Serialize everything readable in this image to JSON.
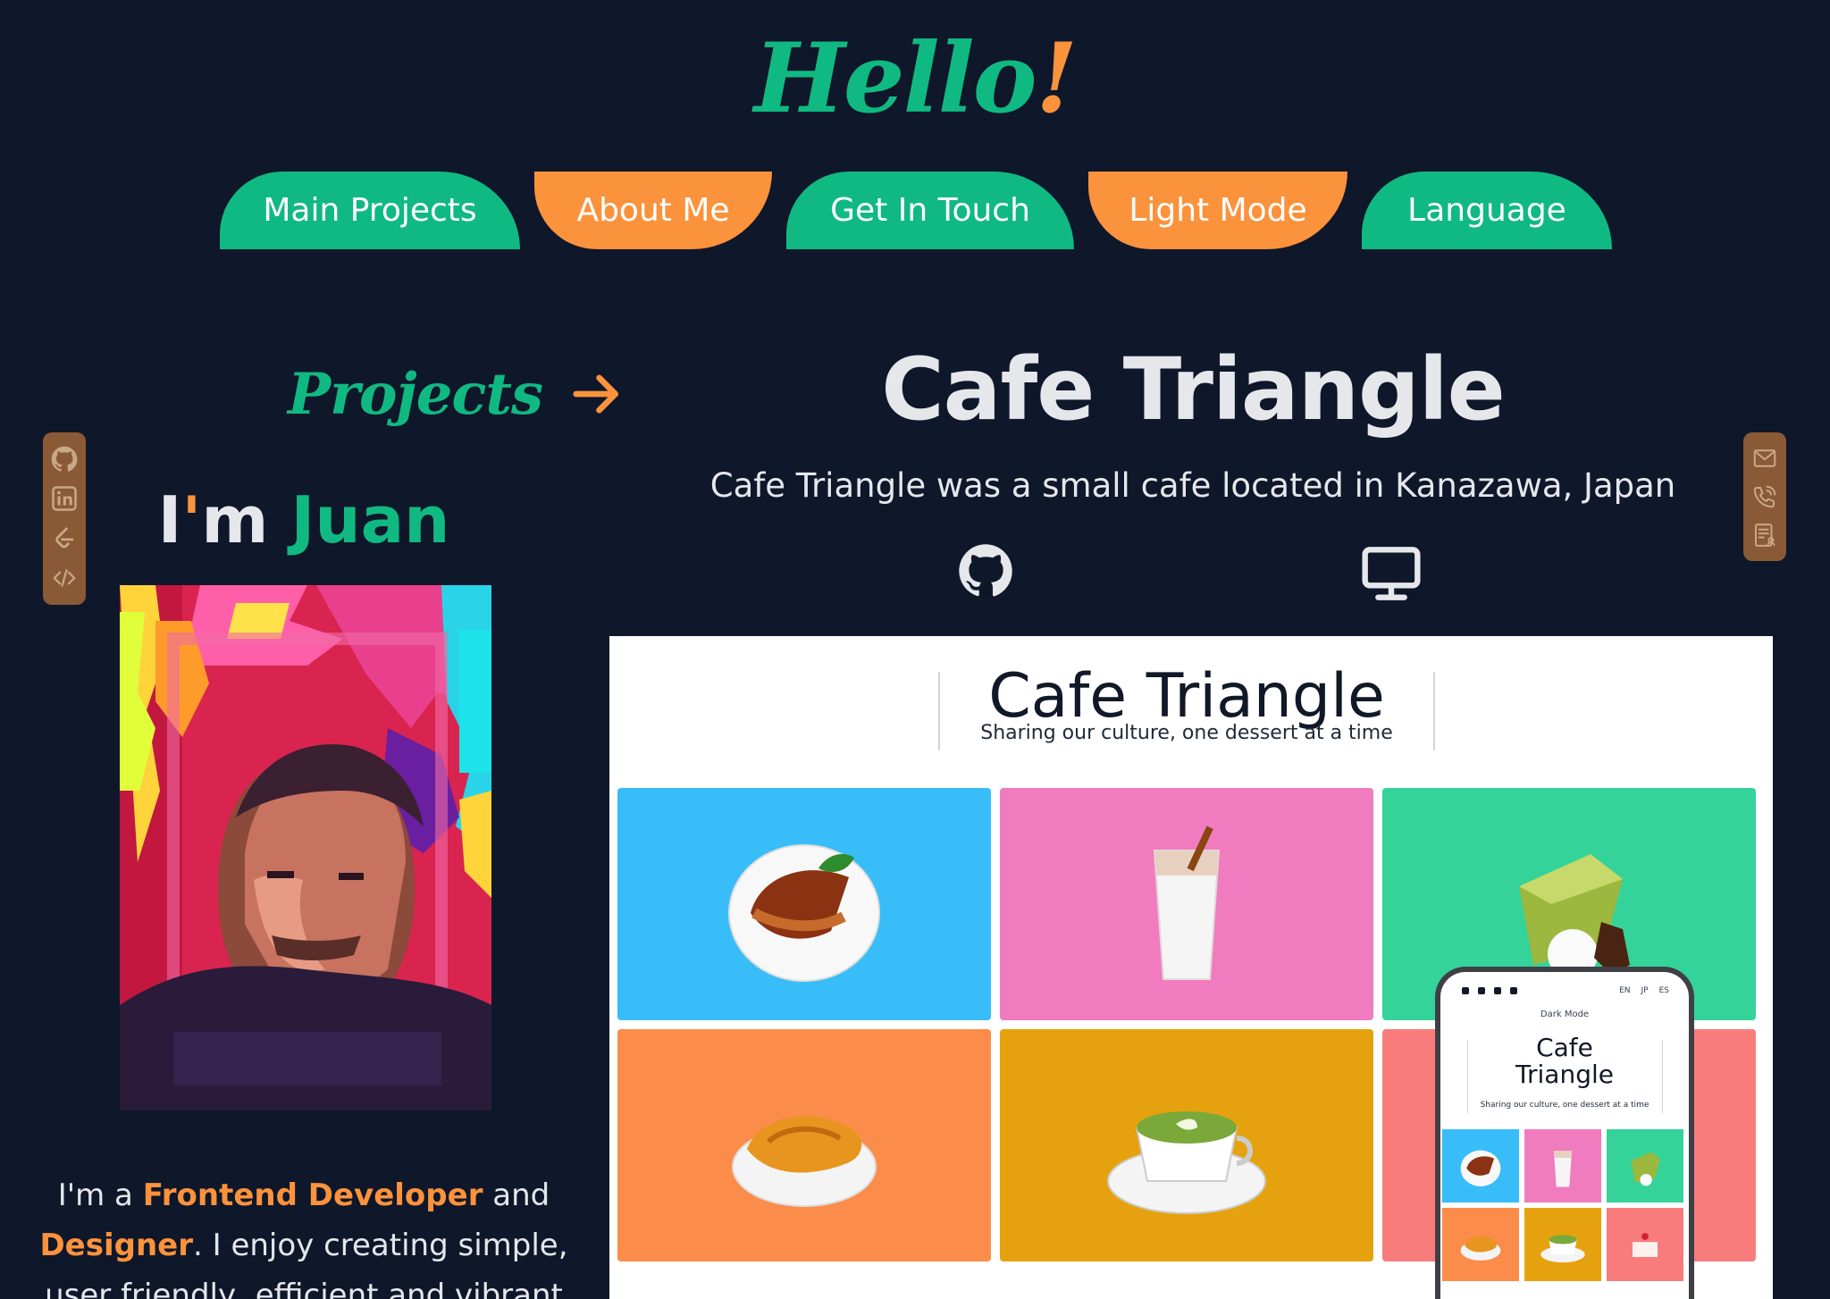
{
  "header": {
    "greeting_word": "Hello",
    "greeting_mark": "!"
  },
  "nav": {
    "items": [
      {
        "label": "Main Projects",
        "color": "#10b981"
      },
      {
        "label": "About Me",
        "color": "#fb923c"
      },
      {
        "label": "Get In Touch",
        "color": "#10b981"
      },
      {
        "label": "Light Mode",
        "color": "#fb923c"
      },
      {
        "label": "Language",
        "color": "#10b981"
      }
    ]
  },
  "left_social": {
    "icons": [
      "github-icon",
      "linkedin-icon",
      "leetcode-icon",
      "code-icon"
    ]
  },
  "right_social": {
    "icons": [
      "mail-icon",
      "phone-icon",
      "resume-icon"
    ]
  },
  "intro": {
    "projects_label": "Projects",
    "im": "I",
    "apostrophe": "'",
    "m": "m",
    "name": "Juan",
    "bio_1": "I'm a ",
    "bio_hl_1": "Frontend Developer",
    "bio_2": " and",
    "bio_hl_2": "Designer",
    "bio_3": ". I enjoy creating simple,",
    "bio_4": "user friendly, efficient and vibrant"
  },
  "project": {
    "title": "Cafe Triangle",
    "description": "Cafe Triangle was a small cafe located in Kanazawa, Japan",
    "links": [
      "github-icon",
      "monitor-icon"
    ]
  },
  "preview": {
    "site_title": "Cafe Triangle",
    "site_subtitle": "Sharing our culture, one dessert at a time",
    "tiles": [
      {
        "name": "dessert-tart",
        "color": "#38bdf8"
      },
      {
        "name": "iced-drink",
        "color": "#f07cbf"
      },
      {
        "name": "matcha-cake",
        "color": "#34d399"
      },
      {
        "name": "taiyaki",
        "color": "#fb8c4a"
      },
      {
        "name": "matcha-latte",
        "color": "#e6a20e"
      },
      {
        "name": "strawberry-cake",
        "color": "#f87c7c"
      }
    ],
    "phone": {
      "langs": [
        "EN",
        "JP",
        "ES"
      ],
      "dark_mode": "Dark Mode",
      "title_line1": "Cafe",
      "title_line2": "Triangle",
      "subtitle": "Sharing our culture, one dessert at a time"
    }
  },
  "colors": {
    "background": "#0f172a",
    "green": "#10b981",
    "orange": "#fb923c",
    "sidebar": "#8a5a36"
  }
}
